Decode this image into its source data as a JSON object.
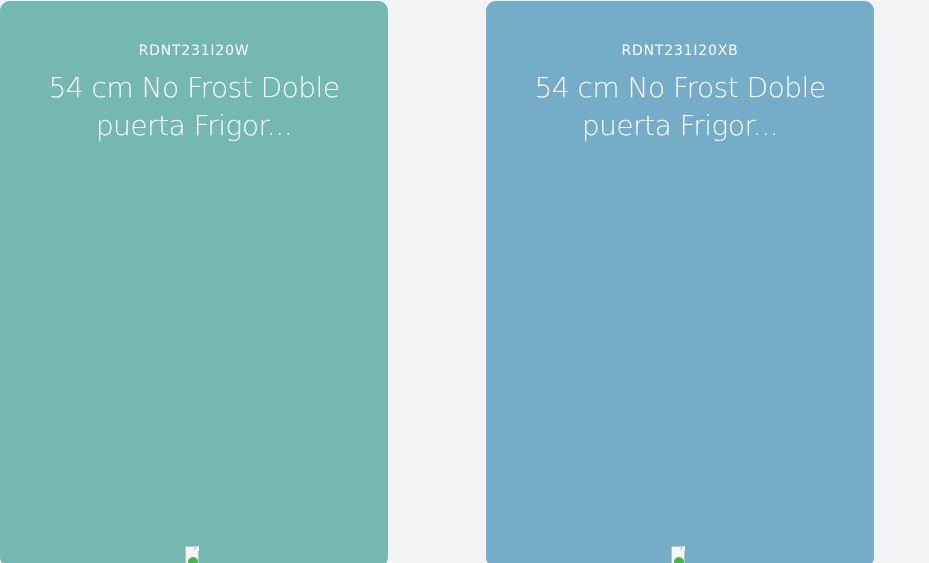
{
  "products": [
    {
      "sku": "RDNT231I20W",
      "title_line1": "54 cm No Frost Doble",
      "title_line2": "puerta Frigor...",
      "card_color": "#74b8b1",
      "image_icon": "broken-image-icon"
    },
    {
      "sku": "RDNT231I20XB",
      "title_line1": "54 cm No Frost Doble",
      "title_line2": "puerta Frigor...",
      "card_color": "#75acc7",
      "image_icon": "broken-image-icon"
    }
  ],
  "page": {
    "background_color": "#f2f3f5"
  }
}
